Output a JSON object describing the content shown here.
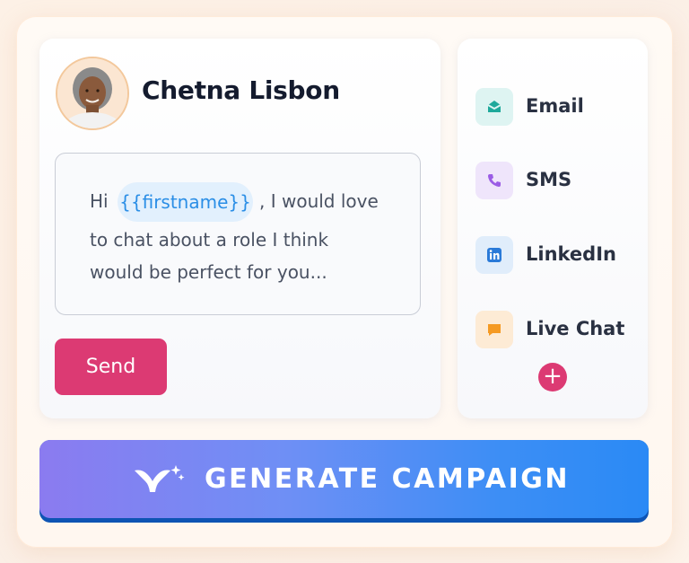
{
  "contact": {
    "name": "Chetna Lisbon"
  },
  "message": {
    "prefix": "Hi",
    "placeholder_token": "{{firstname}}",
    "line1_suffix": ", I would love",
    "line2": "to chat about a role I think",
    "line3": "would be perfect for you..."
  },
  "actions": {
    "send_label": "Send",
    "add_channel_label": "+",
    "generate_label": "GENERATE CAMPAIGN"
  },
  "channels": [
    {
      "label": "Email",
      "icon": "envelope-icon",
      "color": "#1fa99b"
    },
    {
      "label": "SMS",
      "icon": "phone-icon",
      "color": "#9b5de5"
    },
    {
      "label": "LinkedIn",
      "icon": "linkedin-icon",
      "color": "#2a7ad8"
    },
    {
      "label": "Live Chat",
      "icon": "chat-bubble-icon",
      "color": "#f59a23"
    }
  ],
  "colors": {
    "accent_pink": "#dc3a73",
    "token_blue": "#2a8ee6",
    "generate_gradient_start": "#8b7bf0",
    "generate_gradient_end": "#2a8af5"
  }
}
